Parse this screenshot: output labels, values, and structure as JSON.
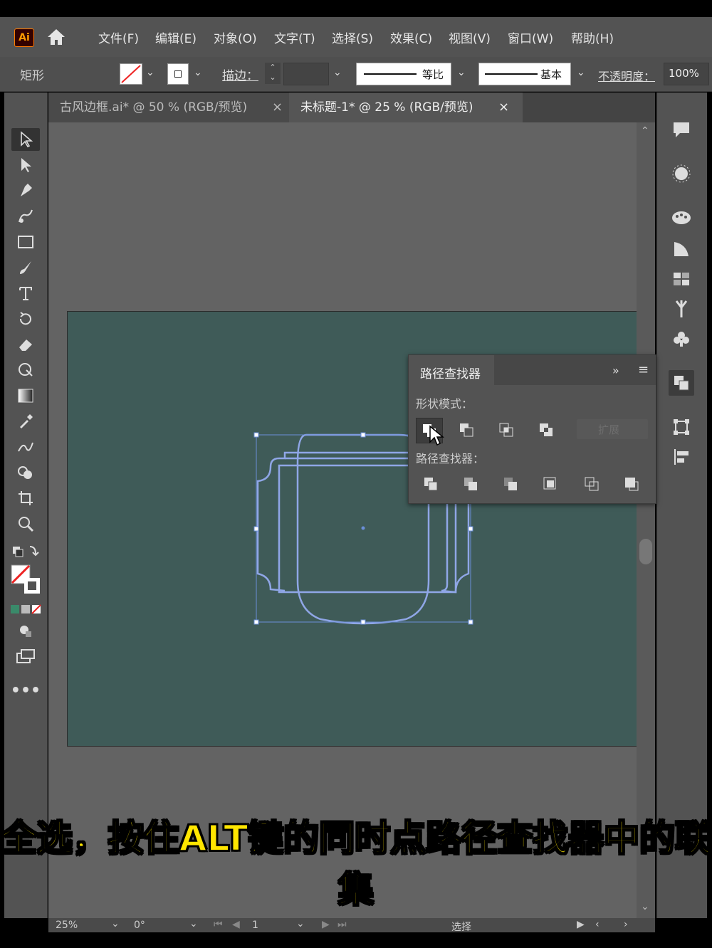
{
  "app": {
    "logo": "Ai"
  },
  "menu": [
    "文件(F)",
    "编辑(E)",
    "对象(O)",
    "文字(T)",
    "选择(S)",
    "效果(C)",
    "视图(V)",
    "窗口(W)",
    "帮助(H)"
  ],
  "control_bar": {
    "object_type": "矩形",
    "stroke_label": "描边：",
    "profile_label": "等比",
    "brush_label": "基本",
    "opacity_label": "不透明度：",
    "opacity_value": "100%"
  },
  "tabs": [
    {
      "label": "古风边框.ai* @ 50 % (RGB/预览)",
      "close": "×",
      "active": false
    },
    {
      "label": "未标题-1* @ 25 % (RGB/预览)",
      "close": "×",
      "active": true
    }
  ],
  "pathfinder_panel": {
    "title": "路径查找器",
    "shape_modes_label": "形状模式：",
    "expand_label": "扩展",
    "pathfinders_label": "路径查找器："
  },
  "status_bar": {
    "zoom": "25%",
    "rotation": "0°",
    "artboard_number": "1",
    "tool_name": "选择"
  },
  "caption": "全选，按住ALT键的同时点路径查找器中的联集",
  "colors": {
    "artboard": "#3f5b58",
    "selection": "#6b8fd8",
    "caption": "#ffe600",
    "ui_panel": "#535353"
  }
}
